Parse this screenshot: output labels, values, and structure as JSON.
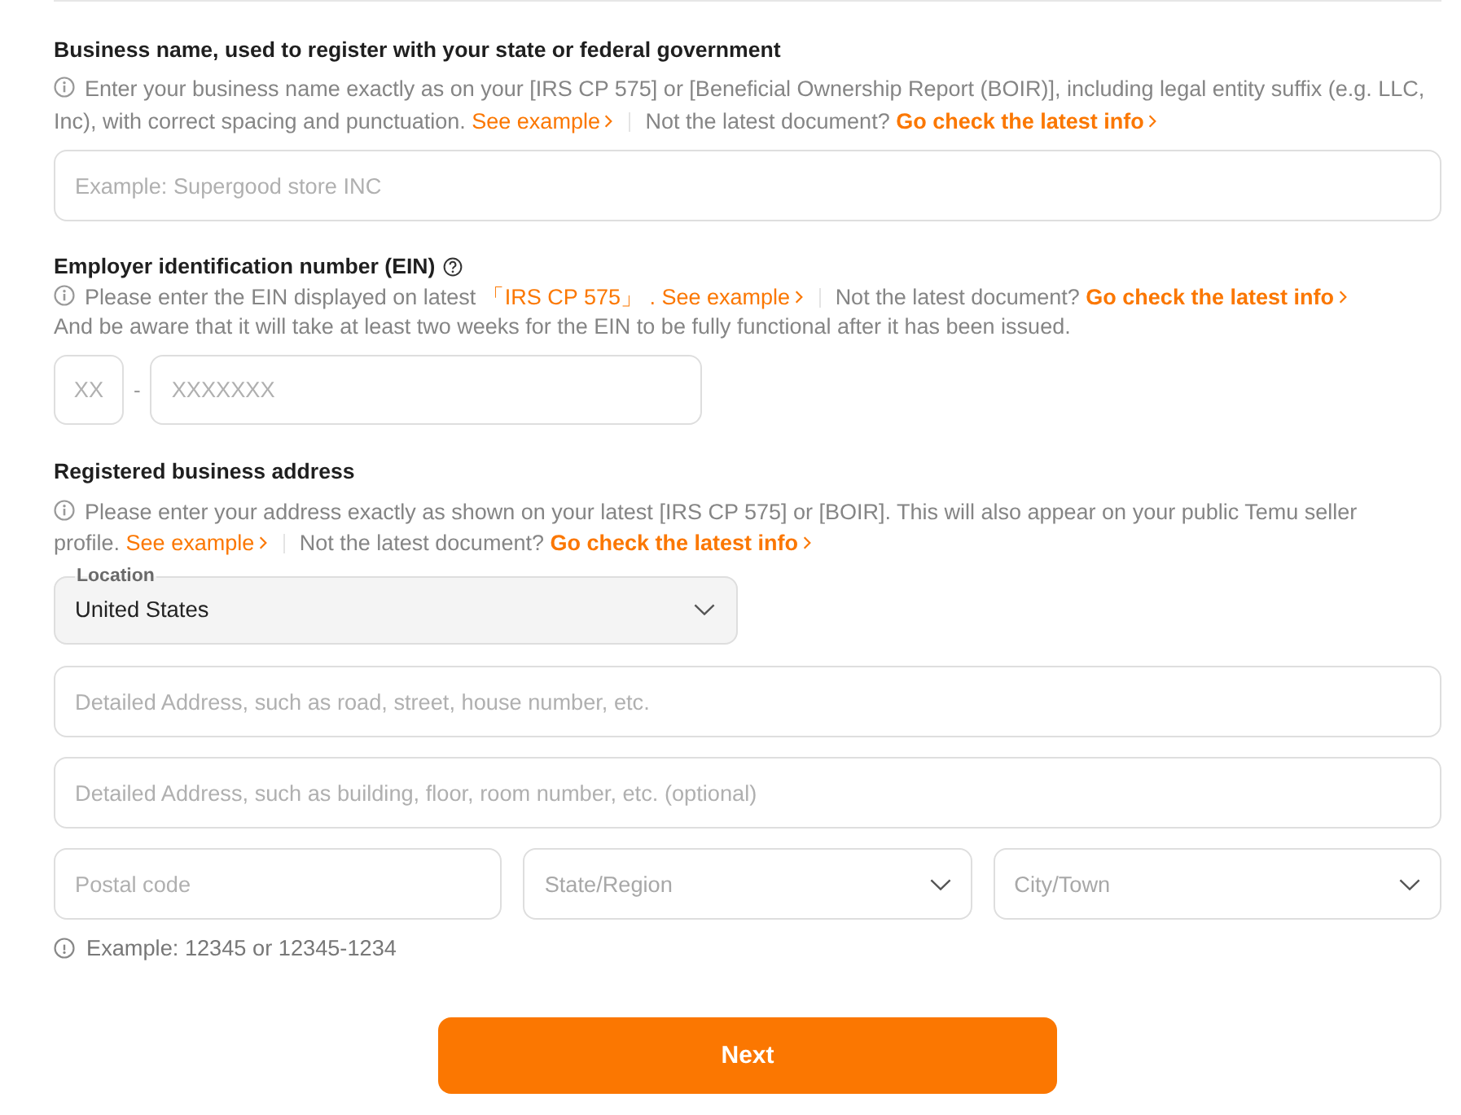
{
  "business_name": {
    "label": "Business name, used to register with your state or federal government",
    "hint": [
      {
        "kind": "text",
        "text": "Enter your business name exactly as on your [IRS CP 575] or [Beneficial Ownership Report (BOIR)], including legal entity suffix (e.g. LLC, Inc), with correct spacing and punctuation."
      },
      {
        "kind": "link",
        "text": "See example",
        "chevron": true
      },
      {
        "kind": "divider"
      },
      {
        "kind": "text",
        "text": "Not the latest document?"
      },
      {
        "kind": "strong_link",
        "text": "Go check the latest info",
        "chevron": true
      }
    ],
    "input": {
      "placeholder": "Example: Supergood store INC"
    }
  },
  "ein": {
    "label": "Employer identification number (EIN)",
    "hint": [
      {
        "kind": "text",
        "text": "Please enter the EIN displayed on latest"
      },
      {
        "kind": "link",
        "text": "「IRS CP 575」",
        "chevron": false
      },
      {
        "kind": "link",
        "text": ". See example",
        "chevron": true
      },
      {
        "kind": "divider"
      },
      {
        "kind": "text",
        "text": "Not the latest document?"
      },
      {
        "kind": "strong_link",
        "text": "Go check the latest info",
        "chevron": true
      }
    ],
    "notice": "And be aware that it will take at least two weeks for the EIN to be fully functional after it has been issued.",
    "prefix_input": {
      "placeholder": "XX"
    },
    "separator": "-",
    "number_input": {
      "placeholder": "XXXXXXX"
    }
  },
  "address": {
    "label": "Registered business address",
    "hint": [
      {
        "kind": "text",
        "text": "Please enter your address exactly as shown on your latest [IRS CP 575] or [BOIR]. This will also appear on your public Temu seller profile."
      },
      {
        "kind": "link",
        "text": "See example",
        "chevron": true
      },
      {
        "kind": "divider"
      },
      {
        "kind": "text",
        "text": "Not the latest document?"
      },
      {
        "kind": "strong_link",
        "text": "Go check the latest info",
        "chevron": true
      }
    ],
    "location": {
      "label": "Location",
      "value": "United States"
    },
    "street_input": {
      "placeholder": "Detailed Address, such as road, street, house number, etc."
    },
    "detail_input": {
      "placeholder": "Detailed Address, such as building, floor, room number, etc. (optional)"
    },
    "postal_input": {
      "placeholder": "Postal code"
    },
    "state_select": {
      "placeholder": "State/Region"
    },
    "city_select": {
      "placeholder": "City/Town"
    },
    "postal_hint": "Example: 12345 or 12345-1234"
  },
  "next_button": {
    "label": "Next"
  }
}
